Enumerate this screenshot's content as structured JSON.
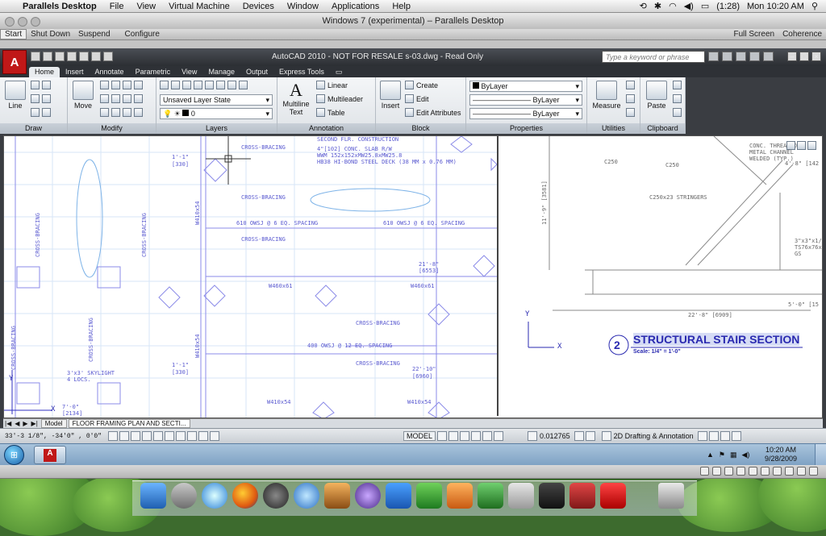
{
  "mac_menubar": {
    "app_name": "Parallels Desktop",
    "menus": [
      "File",
      "View",
      "Virtual Machine",
      "Devices",
      "Window",
      "Applications",
      "Help"
    ],
    "battery": "(1:28)",
    "clock": "Mon 10:20 AM"
  },
  "parallels": {
    "window_title": "Windows 7 (experimental) – Parallels Desktop",
    "toolbar_left": [
      "Start",
      "Shut Down",
      "Suspend",
      "Configure"
    ],
    "toolbar_right": [
      "Full Screen",
      "Coherence"
    ]
  },
  "autocad": {
    "title": "AutoCAD 2010 - NOT FOR RESALE    s-03.dwg - Read Only",
    "logo": "A",
    "search_placeholder": "Type a keyword or phrase",
    "tabs": [
      "Home",
      "Insert",
      "Annotate",
      "Parametric",
      "View",
      "Manage",
      "Output",
      "Express Tools"
    ],
    "active_tab": "Home",
    "panels": {
      "draw": {
        "title": "Draw",
        "line_label": "Line"
      },
      "modify": {
        "title": "Modify",
        "move_label": "Move"
      },
      "layers": {
        "title": "Layers",
        "layer_state": "Unsaved Layer State",
        "current_layer": "0"
      },
      "annotation": {
        "title": "Annotation",
        "multiline_label": "Multiline Text",
        "linear_label": "Linear",
        "multileader_label": "Multileader",
        "table_label": "Table"
      },
      "block": {
        "title": "Block",
        "insert_label": "Insert",
        "create_label": "Create",
        "edit_label": "Edit",
        "edit_attributes_label": "Edit Attributes"
      },
      "properties": {
        "title": "Properties",
        "color": "ByLayer",
        "linetype": "ByLayer",
        "lineweight": "ByLayer"
      },
      "utilities": {
        "title": "Utilities",
        "measure_label": "Measure"
      },
      "clipboard": {
        "title": "Clipboard",
        "paste_label": "Paste"
      }
    },
    "drawing": {
      "left_texts": [
        "SECOND FLR. CONSTRUCTION",
        "4\"[102] CONC. SLAB R/W",
        "WWM 152x152xMW25.8xMW25.8",
        "HB38 HI-BOND STEEL DECK (38 MM x 0.76 MM)",
        "CROSS-BRACING",
        "610 OWSJ @ 6 EQ. SPACING",
        "610 OWSJ @ 6 EQ. SPACING",
        "CROSS-BRACING",
        "21'-8\"",
        "[6553]",
        "W460x61",
        "W460x61",
        "CROSS-BRACING",
        "400 OWSJ @ 12 EQ. SPACING",
        "CROSS-BRACING",
        "22'-10\"",
        "[6960]",
        "W410x54",
        "W410x54",
        "1'-1\"",
        "[330]",
        "1'-1\"",
        "[330]",
        "3'x3' SKYLIGHT",
        "4 LOCS.",
        "W410x54",
        "W410x54",
        "CROSS-BRACING",
        "CROSS-BRACING",
        "CROSS-BRACING",
        "CROSS-BRACING",
        "CROSS-BRACING",
        "7'-0\"",
        "[2134]"
      ],
      "right_texts": [
        "CONC. THREAD ON",
        "METAL CHANNEL",
        "WELDED (TYP.)",
        "11'-9\" [3581]",
        "C250",
        "C250x23 STRINGERS",
        "C250",
        "4'-8\" [142",
        "22'-8\" [6909]",
        "5'-0\" [15",
        "3\"x3\"x1/4\"",
        "TS76x76x6",
        "GS"
      ],
      "section_number": "2",
      "section_title": "STRUCTURAL STAIR SECTION",
      "section_scale": "Scale: 1/4\" = 1'-0\"",
      "axis_y": "Y",
      "axis_x": "X"
    },
    "layout_tabs": [
      "Model",
      "FLOOR FRAMING PLAN AND SECTI..."
    ],
    "status": {
      "coords": "33'-3 1/8\",  -34'0\"  , 0'0\"",
      "model": "MODEL",
      "scale": "0.012765",
      "workspace": "2D Drafting & Annotation"
    }
  },
  "windows": {
    "time": "10:20 AM",
    "date": "9/28/2009"
  }
}
